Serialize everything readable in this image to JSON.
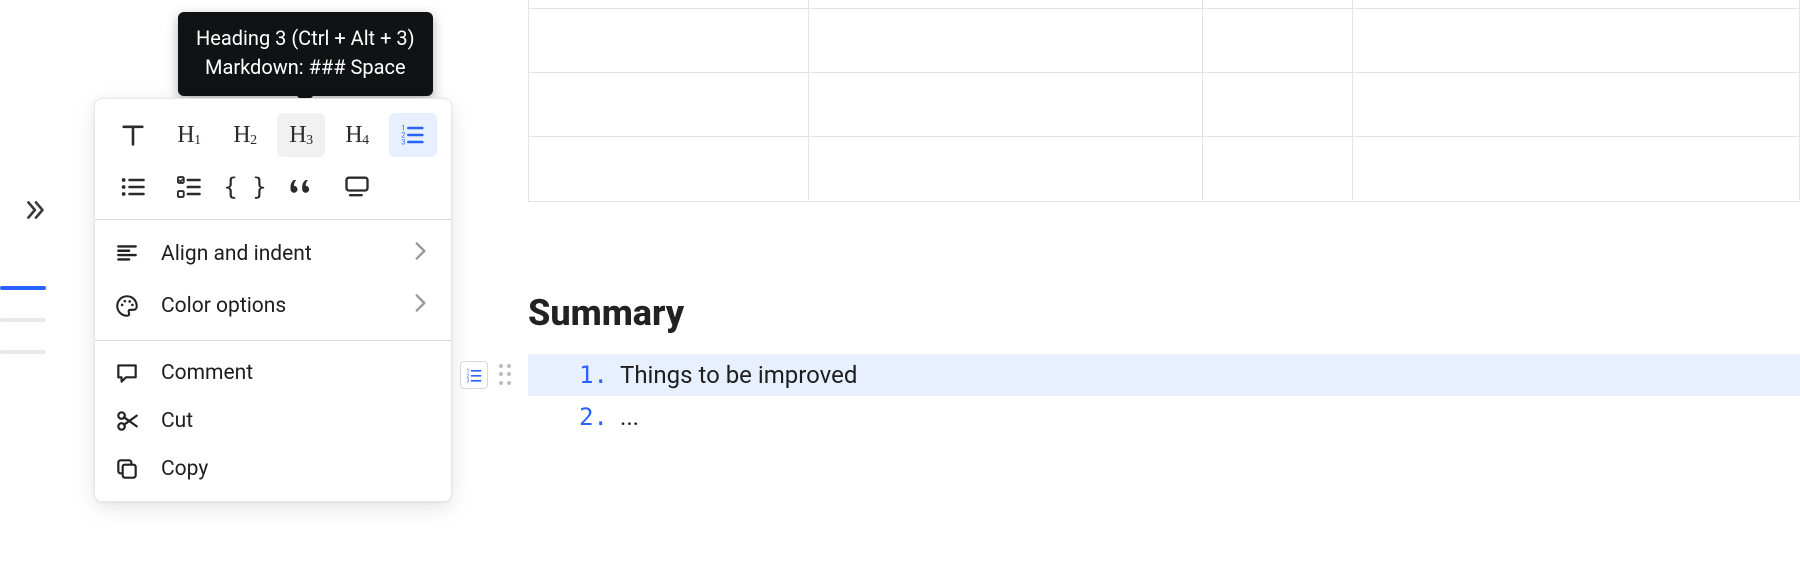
{
  "tooltip": {
    "line1": "Heading 3 (Ctrl + Alt + 3)",
    "line2": "Markdown: ### Space"
  },
  "format_panel": {
    "row1": [
      {
        "name": "paragraph-text-button",
        "icon": "text-t",
        "active": false,
        "blue": false
      },
      {
        "name": "heading1-button",
        "icon": "h1",
        "active": false,
        "blue": false
      },
      {
        "name": "heading2-button",
        "icon": "h2",
        "active": false,
        "blue": false
      },
      {
        "name": "heading3-button",
        "icon": "h3",
        "active": true,
        "blue": false
      },
      {
        "name": "heading4-button",
        "icon": "h4",
        "active": false,
        "blue": false
      },
      {
        "name": "numbered-list-button",
        "icon": "ol",
        "active": false,
        "blue": true
      }
    ],
    "row2": [
      {
        "name": "bulleted-list-button",
        "icon": "ul"
      },
      {
        "name": "checklist-button",
        "icon": "checklist"
      },
      {
        "name": "code-block-button",
        "icon": "code"
      },
      {
        "name": "blockquote-button",
        "icon": "quote"
      },
      {
        "name": "callout-button",
        "icon": "card"
      }
    ],
    "menu": [
      {
        "name": "align-indent-menu",
        "icon": "align",
        "label": "Align and indent",
        "chevron": true
      },
      {
        "name": "color-options-menu",
        "icon": "palette",
        "label": "Color options",
        "chevron": true
      }
    ],
    "actions": [
      {
        "name": "comment-action",
        "icon": "comment",
        "label": "Comment"
      },
      {
        "name": "cut-action",
        "icon": "cut",
        "label": "Cut"
      },
      {
        "name": "copy-action",
        "icon": "copy",
        "label": "Copy"
      }
    ]
  },
  "document": {
    "heading": "Summary",
    "ordered_list": [
      {
        "num": "1.",
        "text": "Things to be improved",
        "selected": true
      },
      {
        "num": "2.",
        "text": "...",
        "selected": false
      }
    ]
  }
}
